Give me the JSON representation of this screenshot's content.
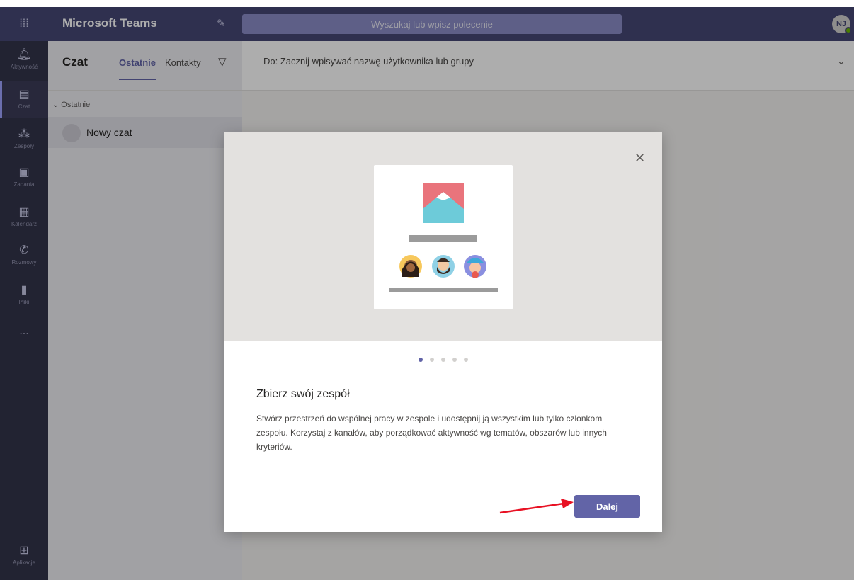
{
  "topbar": {
    "app_title": "Microsoft Teams",
    "search_placeholder": "Wyszukaj lub wpisz polecenie",
    "avatar_initials": "NJ"
  },
  "rail": {
    "items": [
      {
        "label": "Aktywność",
        "icon": "bell-icon"
      },
      {
        "label": "Czat",
        "icon": "chat-icon"
      },
      {
        "label": "Zespoły",
        "icon": "teams-icon"
      },
      {
        "label": "Zadania",
        "icon": "assignments-icon"
      },
      {
        "label": "Kalendarz",
        "icon": "calendar-icon"
      },
      {
        "label": "Rozmowy",
        "icon": "phone-icon"
      },
      {
        "label": "Pliki",
        "icon": "files-icon"
      },
      {
        "label": "...",
        "icon": "more-icon"
      },
      {
        "label": "Aplikacje",
        "icon": "apps-icon"
      }
    ]
  },
  "chatlist": {
    "title": "Czat",
    "tabs": [
      "Ostatnie",
      "Kontakty"
    ],
    "section_label": "Ostatnie",
    "chats": [
      {
        "name": "Nowy czat"
      }
    ]
  },
  "main": {
    "to_prefix": "Do:",
    "to_placeholder": "Zacznij wpisywać nazwę użytkownika lub grupy"
  },
  "dialog": {
    "heading": "Zbierz swój zespół",
    "description": "Stwórz przestrzeń do wspólnej pracy w zespole i udostępnij ją wszystkim lub tylko członkom zespołu. Korzystaj z kanałów, aby porządkować aktywność wg tematów, obszarów lub innych kryteriów.",
    "next_label": "Dalej",
    "page_count": 5,
    "current_page": 1
  },
  "colors": {
    "brand": "#6264a7",
    "topbar": "#464775",
    "rail": "#33344a",
    "annotation_arrow": "#e81123"
  }
}
